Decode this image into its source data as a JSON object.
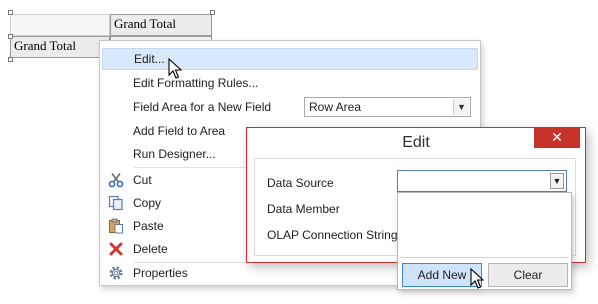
{
  "pivot": {
    "header_total": "Grand Total",
    "row_total": "Grand Total"
  },
  "context_menu": {
    "items": [
      {
        "label": "Edit...",
        "highlighted": true
      },
      {
        "label": "Edit Formatting Rules..."
      },
      {
        "label": "Field Area for a New Field"
      },
      {
        "label": "Add Field to Area"
      },
      {
        "label": "Run Designer..."
      },
      {
        "label": "Cut",
        "icon": "scissors-icon"
      },
      {
        "label": "Copy",
        "icon": "copy-icon"
      },
      {
        "label": "Paste",
        "icon": "paste-icon"
      },
      {
        "label": "Delete",
        "icon": "delete-icon"
      },
      {
        "label": "Properties",
        "icon": "gear-icon"
      }
    ],
    "field_area_value": "Row Area"
  },
  "dialog": {
    "title": "Edit",
    "close_glyph": "✕",
    "fields": [
      {
        "label": "Data Source",
        "value": ""
      },
      {
        "label": "Data Member"
      },
      {
        "label": "OLAP Connection String"
      }
    ],
    "dropdown": {
      "add_new_label": "Add New",
      "clear_label": "Clear"
    }
  },
  "colors": {
    "highlight": "#d9e8fb",
    "close_button": "#c7322b",
    "add_new_button": "#cfe4fb"
  }
}
